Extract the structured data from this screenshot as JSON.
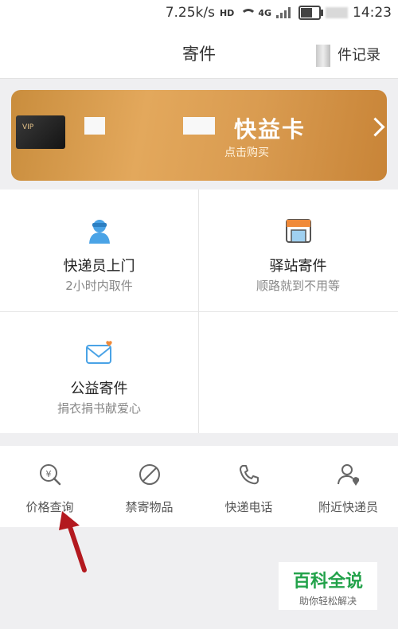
{
  "status": {
    "speed": "7.25k/s",
    "hd": "HD",
    "net": "4G",
    "time": "14:23"
  },
  "header": {
    "title": "寄件",
    "record": "件记录"
  },
  "banner": {
    "title": "快益卡",
    "subtitle": "点击购买",
    "card_text": "VIP"
  },
  "services": [
    {
      "title": "快递员上门",
      "subtitle": "2小时内取件"
    },
    {
      "title": "驿站寄件",
      "subtitle": "顺路就到不用等"
    },
    {
      "title": "公益寄件",
      "subtitle": "捐衣捐书献爱心"
    }
  ],
  "tools": [
    {
      "label": "价格查询"
    },
    {
      "label": "禁寄物品"
    },
    {
      "label": "快递电话"
    },
    {
      "label": "附近快递员"
    }
  ],
  "watermark": {
    "title": "百科全说",
    "subtitle": "助你轻松解决"
  },
  "colors": {
    "accent": "#f08a39",
    "banner": "#d99b50"
  }
}
